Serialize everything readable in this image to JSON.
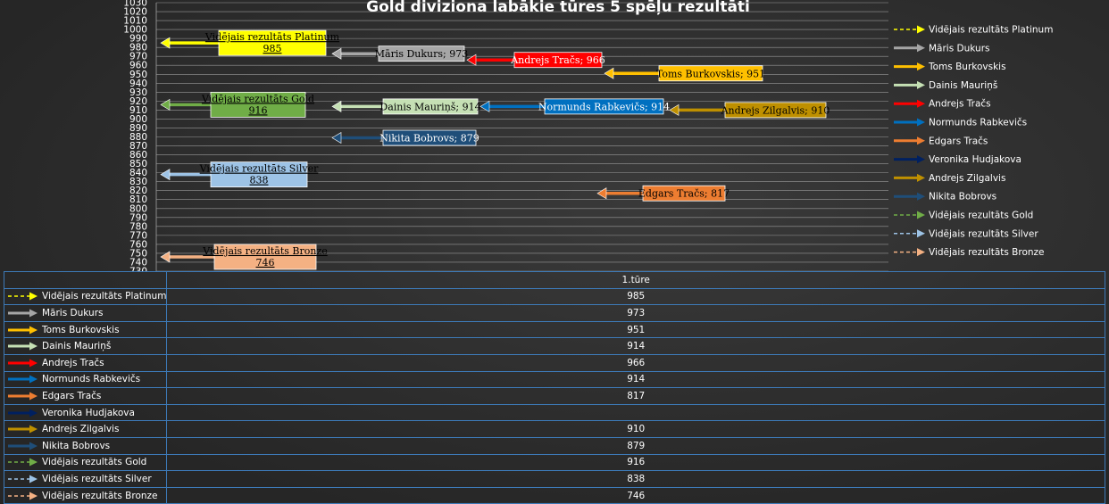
{
  "chart_data": {
    "type": "bar",
    "title": "Gold diviziona labākie tūres 5 spēļu rezultāti",
    "category": "1.tūre",
    "ylim": [
      730,
      1030
    ],
    "ytick_step": 10,
    "grid": true,
    "legend_position": "right",
    "series": [
      {
        "name": "Vidējais rezultāts Platinum",
        "value": 985,
        "color": "#ffff00",
        "style": "dashed",
        "label": "Vidējais rezultāts Platinum\n985",
        "text_color": "#000000"
      },
      {
        "name": "Māris Dukurs",
        "value": 973,
        "color": "#a6a6a6",
        "style": "solid",
        "label": "Māris Dukurs; 973",
        "text_color": "#000000"
      },
      {
        "name": "Toms Burkovskis",
        "value": 951,
        "color": "#ffc000",
        "style": "solid",
        "label": "Toms Burkovskis; 951",
        "text_color": "#000000"
      },
      {
        "name": "Dainis Mauriņš",
        "value": 914,
        "color": "#c5e0b4",
        "style": "solid",
        "label": "Dainis Mauriņš; 914",
        "text_color": "#000000"
      },
      {
        "name": "Andrejs Tračs",
        "value": 966,
        "color": "#ff0000",
        "style": "solid",
        "label": "Andrejs Tračs; 966",
        "text_color": "#ffffff"
      },
      {
        "name": "Normunds Rabkevičs",
        "value": 914,
        "color": "#0070c0",
        "style": "solid",
        "label": "Normunds Rabkevičs; 914",
        "text_color": "#ffffff"
      },
      {
        "name": "Edgars Tračs",
        "value": 817,
        "color": "#ed7d31",
        "style": "solid",
        "label": "Edgars Tračs; 817",
        "text_color": "#000000"
      },
      {
        "name": "Veronika Hudjakova",
        "value": null,
        "color": "#002060",
        "style": "solid",
        "label": "",
        "text_color": "#ffffff"
      },
      {
        "name": "Andrejs Zilgalvis",
        "value": 910,
        "color": "#bf9000",
        "style": "solid",
        "label": "Andrejs Zilgalvis; 910",
        "text_color": "#000000"
      },
      {
        "name": "Nikita Bobrovs",
        "value": 879,
        "color": "#1f4e79",
        "style": "solid",
        "label": "Nikita Bobrovs; 879",
        "text_color": "#ffffff"
      },
      {
        "name": "Vidējais rezultāts Gold",
        "value": 916,
        "color": "#70ad47",
        "style": "dashed",
        "label": "Vidējais rezultāts Gold\n916",
        "text_color": "#000000"
      },
      {
        "name": "Vidējais rezultāts Silver",
        "value": 838,
        "color": "#9dc3e6",
        "style": "dashed",
        "label": "Vidējais rezultāts Silver\n838",
        "text_color": "#000000"
      },
      {
        "name": "Vidējais rezultāts Bronze",
        "value": 746,
        "color": "#f4b183",
        "style": "dashed",
        "label": "Vidējais rezultāts Bronze\n746",
        "text_color": "#000000"
      }
    ]
  }
}
